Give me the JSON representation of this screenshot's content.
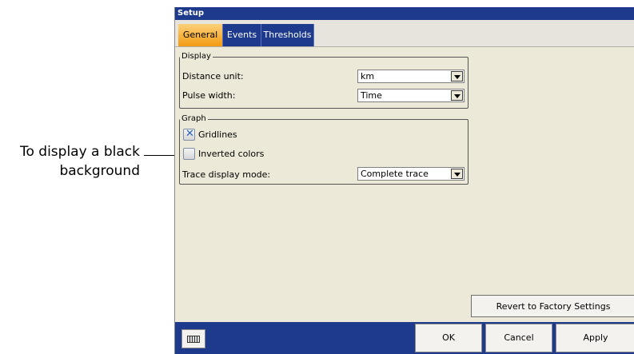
{
  "callout": {
    "line1": "To display a black",
    "line2": "background"
  },
  "window": {
    "title": "Setup"
  },
  "tabs": [
    {
      "label": "General",
      "active": true
    },
    {
      "label": "Events",
      "active": false
    },
    {
      "label": "Thresholds",
      "active": false
    }
  ],
  "display_group": {
    "legend": "Display",
    "distance_unit_label": "Distance unit:",
    "distance_unit_value": "km",
    "pulse_width_label": "Pulse width:",
    "pulse_width_value": "Time"
  },
  "graph_group": {
    "legend": "Graph",
    "gridlines_label": "Gridlines",
    "gridlines_checked": true,
    "inverted_colors_label": "Inverted colors",
    "inverted_colors_checked": false,
    "trace_mode_label": "Trace display mode:",
    "trace_mode_value": "Complete trace"
  },
  "buttons": {
    "revert": "Revert to Factory Settings",
    "ok": "OK",
    "cancel": "Cancel",
    "apply": "Apply"
  },
  "icons": {
    "keyboard": "keyboard-icon",
    "dropdown": "chevron-down-icon",
    "check": "check-x-icon"
  },
  "colors": {
    "titlebar": "#1d3a8d",
    "active_tab": "#f29a12",
    "window_bg": "#ece9d8"
  }
}
